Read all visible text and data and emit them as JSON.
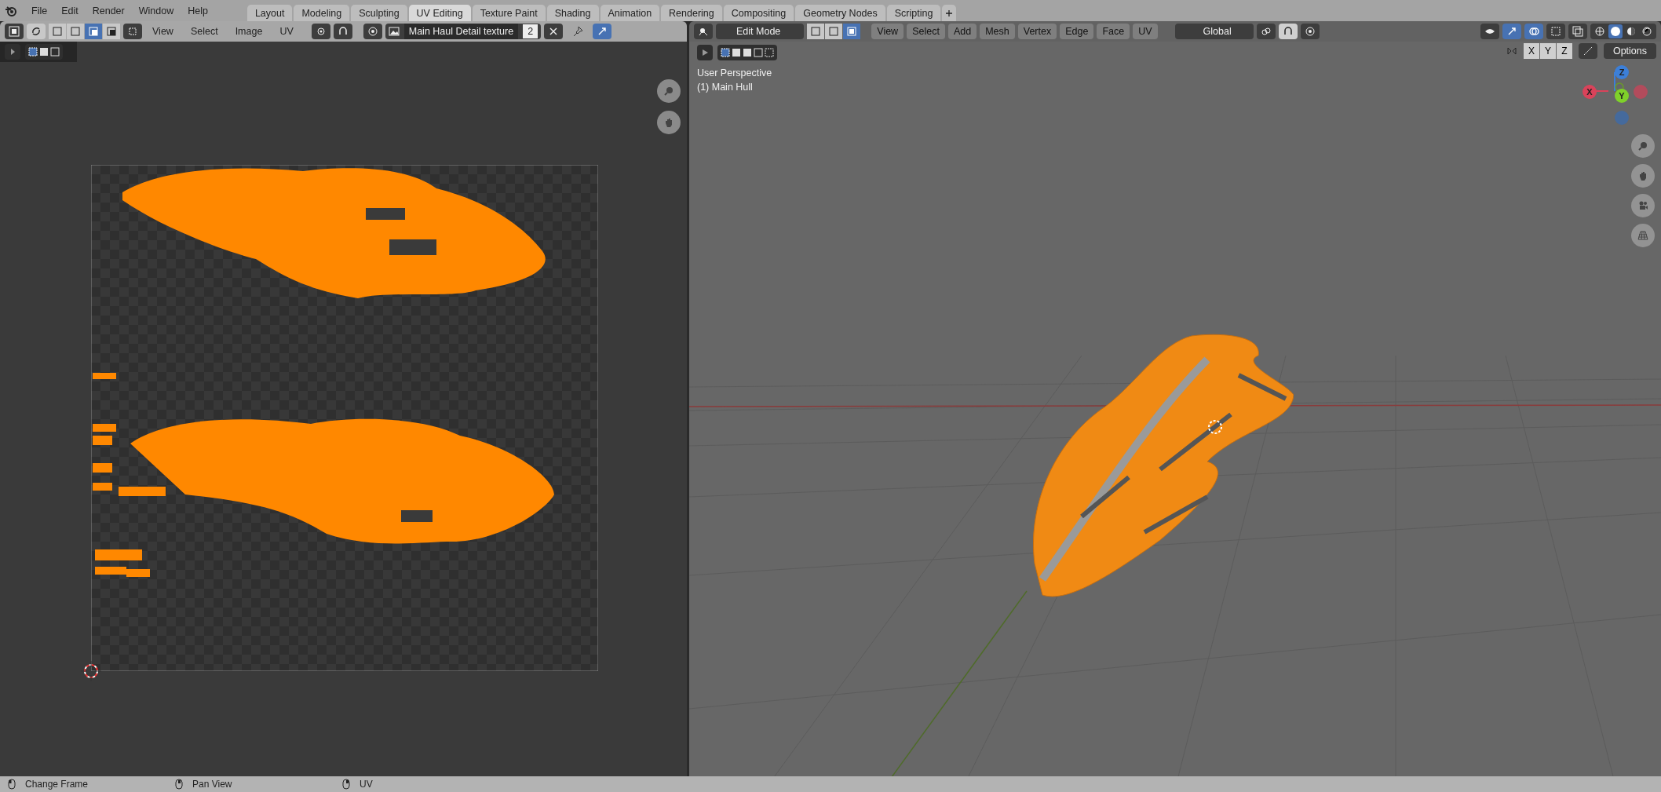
{
  "menu": [
    "File",
    "Edit",
    "Render",
    "Window",
    "Help"
  ],
  "workspaces": [
    {
      "label": "Layout",
      "selected": false
    },
    {
      "label": "Modeling",
      "selected": false
    },
    {
      "label": "Sculpting",
      "selected": false
    },
    {
      "label": "UV Editing",
      "selected": true
    },
    {
      "label": "Texture Paint",
      "selected": false
    },
    {
      "label": "Shading",
      "selected": false
    },
    {
      "label": "Animation",
      "selected": false
    },
    {
      "label": "Rendering",
      "selected": false
    },
    {
      "label": "Compositing",
      "selected": false
    },
    {
      "label": "Geometry Nodes",
      "selected": false
    },
    {
      "label": "Scripting",
      "selected": false
    }
  ],
  "uv_editor": {
    "select_modes": [
      {
        "selected": false
      },
      {
        "selected": false
      },
      {
        "selected": true
      },
      {
        "selected": false
      }
    ],
    "menus": [
      "View",
      "Select",
      "Image",
      "UV"
    ],
    "image_name": "Main Haul Detail texture",
    "users": "2"
  },
  "viewport_header": {
    "mode": "Edit Mode",
    "select_modes": [
      {
        "selected": false
      },
      {
        "selected": false
      },
      {
        "selected": true
      }
    ],
    "menus": [
      "View",
      "Select",
      "Add",
      "Mesh",
      "Vertex",
      "Edge",
      "Face",
      "UV"
    ],
    "orientation": "Global",
    "axes": [
      "X",
      "Y",
      "Z"
    ],
    "options": "Options"
  },
  "viewport": {
    "overlay_text": [
      "User Perspective",
      "(1) Main Hull"
    ],
    "gizmo": {
      "z": "Z",
      "x": "X",
      "y": "Y"
    }
  },
  "status_bar": [
    "Change Frame",
    "Pan View",
    "UV"
  ]
}
